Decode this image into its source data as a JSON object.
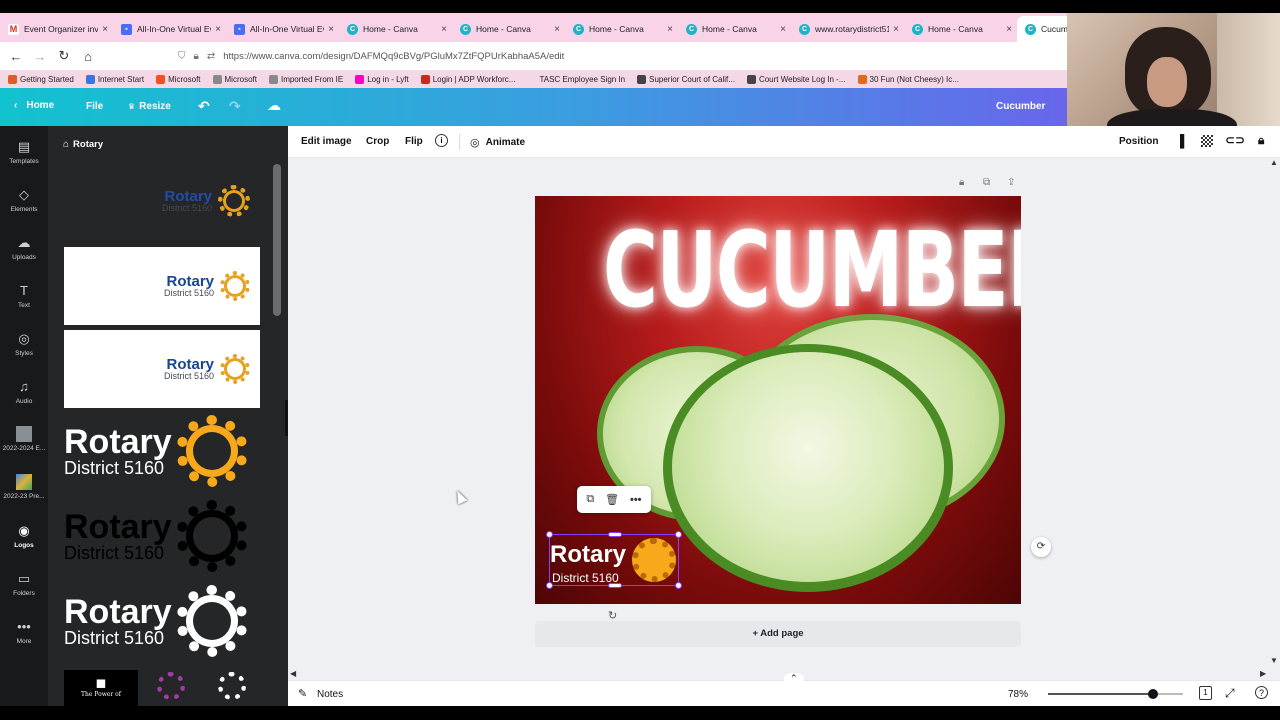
{
  "browser": {
    "tabs": [
      {
        "title": "Event Organizer invit",
        "icon": "gmail",
        "active": false
      },
      {
        "title": "All-In-One Virtual Ev",
        "icon": "event",
        "active": false
      },
      {
        "title": "All-In-One Virtual Ev",
        "icon": "event",
        "active": false
      },
      {
        "title": "Home - Canva",
        "icon": "canva",
        "active": false
      },
      {
        "title": "Home - Canva",
        "icon": "canva",
        "active": false
      },
      {
        "title": "Home - Canva",
        "icon": "canva",
        "active": false
      },
      {
        "title": "Home - Canva",
        "icon": "canva",
        "active": false
      },
      {
        "title": "www.rotarydistrict51(",
        "icon": "canva",
        "active": false
      },
      {
        "title": "Home - Canva",
        "icon": "canva",
        "active": false
      },
      {
        "title": "Cucum",
        "icon": "canva",
        "active": true
      }
    ],
    "url": "https://www.canva.com/design/DAFMQq9cBVg/PGluMx7ZtFQPUrKabhaA5A/edit",
    "bookmarks": [
      {
        "label": "Getting Started",
        "color": "#e8572a"
      },
      {
        "label": "Internet Start",
        "color": "#2f7ae5"
      },
      {
        "label": "Microsoft",
        "color": "#f25022"
      },
      {
        "label": "Microsoft",
        "color": "#888888"
      },
      {
        "label": "Imported From IE",
        "color": "#888888"
      },
      {
        "label": "Log in - Lyft",
        "color": "#ff00bf"
      },
      {
        "label": "Login | ADP Workforc...",
        "color": "#d0271d"
      },
      {
        "label": "TASC Employee Sign In",
        "color": "#f5d8e6"
      },
      {
        "label": "Superior Court of Calif...",
        "color": "#444444"
      },
      {
        "label": "Court Website Log In -...",
        "color": "#444444"
      },
      {
        "label": "30 Fun (Not Cheesy) Ic...",
        "color": "#e06b1f"
      }
    ]
  },
  "header": {
    "home": "Home",
    "file": "File",
    "resize": "Resize",
    "project_name": "Cucumber"
  },
  "rail": [
    {
      "label": "Templates",
      "icon": "templates-icon",
      "glyph": "▤"
    },
    {
      "label": "Elements",
      "icon": "elements-icon",
      "glyph": "◇"
    },
    {
      "label": "Uploads",
      "icon": "uploads-icon",
      "glyph": "☁"
    },
    {
      "label": "Text",
      "icon": "text-icon",
      "glyph": "T"
    },
    {
      "label": "Styles",
      "icon": "styles-icon",
      "glyph": "◎"
    },
    {
      "label": "Audio",
      "icon": "audio-icon",
      "glyph": "♫"
    },
    {
      "label": "2022-2024 E...",
      "icon": "folder-thumb-icon",
      "glyph": ""
    },
    {
      "label": "2022-23 Pre...",
      "icon": "folder-thumb-icon",
      "glyph": ""
    },
    {
      "label": "Logos",
      "icon": "logos-icon",
      "glyph": "◉",
      "active": true
    },
    {
      "label": "Folders",
      "icon": "folders-icon",
      "glyph": "▭"
    },
    {
      "label": "More",
      "icon": "more-icon",
      "glyph": "•••"
    }
  ],
  "panel": {
    "title": "Rotary",
    "logos": [
      {
        "name": "Rotary",
        "district": "District 5160",
        "bg": "transparent",
        "text_color": "#1e4ea8",
        "wheel": "#e6a11e"
      },
      {
        "name": "Rotary",
        "district": "District 5160",
        "bg": "#ffffff",
        "text_color": "#17458f",
        "wheel": "#e6a11e"
      },
      {
        "name": "Rotary",
        "district": "District 5160",
        "bg": "#ffffff",
        "text_color": "#17458f",
        "wheel": "#e6a11e"
      },
      {
        "name": "Rotary",
        "district": "District 5160",
        "bg": "transparent",
        "text_color": "#ffffff",
        "wheel": "#f7a81b"
      },
      {
        "name": "Rotary",
        "district": "District 5160",
        "bg": "transparent",
        "text_color": "#000000",
        "wheel": "#000000"
      },
      {
        "name": "Rotary",
        "district": "District 5160",
        "bg": "transparent",
        "text_color": "#ffffff",
        "wheel": "#ffffff"
      }
    ],
    "bottom_thumb_caption": "The Power of"
  },
  "toolbar": {
    "edit_image": "Edit image",
    "crop": "Crop",
    "flip": "Flip",
    "animate": "Animate",
    "position": "Position"
  },
  "design": {
    "headline": "CUCUMBER",
    "logo_name": "Rotary",
    "logo_district": "District 5160"
  },
  "canvas": {
    "add_page": "+ Add page"
  },
  "bottom": {
    "notes": "Notes",
    "zoom": "78%",
    "zoom_fraction": 0.78,
    "page_count": "1"
  }
}
